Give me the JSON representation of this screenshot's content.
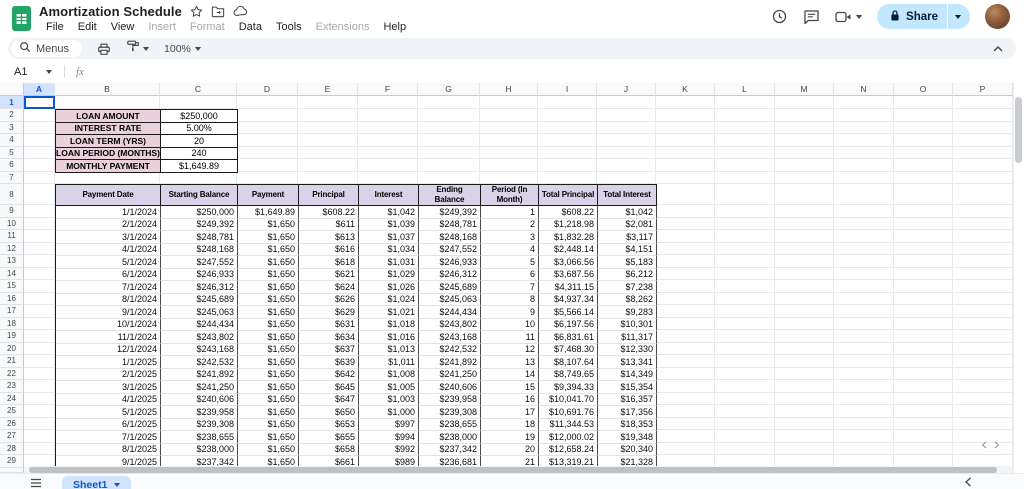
{
  "header": {
    "title": "Amortization Schedule",
    "menus": [
      {
        "label": "File",
        "muted": false
      },
      {
        "label": "Edit",
        "muted": false
      },
      {
        "label": "View",
        "muted": false
      },
      {
        "label": "Insert",
        "muted": true
      },
      {
        "label": "Format",
        "muted": true
      },
      {
        "label": "Data",
        "muted": false
      },
      {
        "label": "Tools",
        "muted": false
      },
      {
        "label": "Extensions",
        "muted": true
      },
      {
        "label": "Help",
        "muted": false
      }
    ],
    "share_label": "Share"
  },
  "toolbar": {
    "search_label": "Menus",
    "zoom_value": "100%"
  },
  "formula_bar": {
    "cell_reference": "A1",
    "formula_value": "",
    "fx_label": "fx"
  },
  "grid": {
    "column_letters": [
      "A",
      "B",
      "C",
      "D",
      "E",
      "F",
      "G",
      "H",
      "I",
      "J",
      "K",
      "L",
      "M",
      "N",
      "O",
      "P"
    ],
    "selected_column": "A",
    "selected_row": 1,
    "row_count": 29,
    "selected_cell": "A1"
  },
  "loan_summary": [
    {
      "label": "LOAN AMOUNT",
      "value": "$250,000"
    },
    {
      "label": "INTEREST RATE",
      "value": "5.00%"
    },
    {
      "label": "LOAN TERM (YRS)",
      "value": "20"
    },
    {
      "label": "LOAN PERIOD (MONTHS)",
      "value": "240"
    },
    {
      "label": "MONTHLY PAYMENT",
      "value": "$1,649.89"
    }
  ],
  "schedule": {
    "headers": [
      "Payment Date",
      "Starting Balance",
      "Payment",
      "Principal",
      "Interest",
      "Ending\nBalance",
      "Period (In\nMonth)",
      "Total Principal",
      "Total Interest"
    ],
    "rows": [
      [
        "1/1/2024",
        "$250,000",
        "$1,649.89",
        "$608.22",
        "$1,042",
        "$249,392",
        "1",
        "$608.22",
        "$1,042"
      ],
      [
        "2/1/2024",
        "$249,392",
        "$1,650",
        "$611",
        "$1,039",
        "$248,781",
        "2",
        "$1,218.98",
        "$2,081"
      ],
      [
        "3/1/2024",
        "$248,781",
        "$1,650",
        "$613",
        "$1,037",
        "$248,168",
        "3",
        "$1,832.28",
        "$3,117"
      ],
      [
        "4/1/2024",
        "$248,168",
        "$1,650",
        "$616",
        "$1,034",
        "$247,552",
        "4",
        "$2,448.14",
        "$4,151"
      ],
      [
        "5/1/2024",
        "$247,552",
        "$1,650",
        "$618",
        "$1,031",
        "$246,933",
        "5",
        "$3,066.56",
        "$5,183"
      ],
      [
        "6/1/2024",
        "$246,933",
        "$1,650",
        "$621",
        "$1,029",
        "$246,312",
        "6",
        "$3,687.56",
        "$6,212"
      ],
      [
        "7/1/2024",
        "$246,312",
        "$1,650",
        "$624",
        "$1,026",
        "$245,689",
        "7",
        "$4,311.15",
        "$7,238"
      ],
      [
        "8/1/2024",
        "$245,689",
        "$1,650",
        "$626",
        "$1,024",
        "$245,063",
        "8",
        "$4,937.34",
        "$8,262"
      ],
      [
        "9/1/2024",
        "$245,063",
        "$1,650",
        "$629",
        "$1,021",
        "$244,434",
        "9",
        "$5,566.14",
        "$9,283"
      ],
      [
        "10/1/2024",
        "$244,434",
        "$1,650",
        "$631",
        "$1,018",
        "$243,802",
        "10",
        "$6,197.56",
        "$10,301"
      ],
      [
        "11/1/2024",
        "$243,802",
        "$1,650",
        "$634",
        "$1,016",
        "$243,168",
        "11",
        "$6,831.61",
        "$11,317"
      ],
      [
        "12/1/2024",
        "$243,168",
        "$1,650",
        "$637",
        "$1,013",
        "$242,532",
        "12",
        "$7,468.30",
        "$12,330"
      ],
      [
        "1/1/2025",
        "$242,532",
        "$1,650",
        "$639",
        "$1,011",
        "$241,892",
        "13",
        "$8,107.64",
        "$13,341"
      ],
      [
        "2/1/2025",
        "$241,892",
        "$1,650",
        "$642",
        "$1,008",
        "$241,250",
        "14",
        "$8,749.65",
        "$14,349"
      ],
      [
        "3/1/2025",
        "$241,250",
        "$1,650",
        "$645",
        "$1,005",
        "$240,606",
        "15",
        "$9,394.33",
        "$15,354"
      ],
      [
        "4/1/2025",
        "$240,606",
        "$1,650",
        "$647",
        "$1,003",
        "$239,958",
        "16",
        "$10,041.70",
        "$16,357"
      ],
      [
        "5/1/2025",
        "$239,958",
        "$1,650",
        "$650",
        "$1,000",
        "$239,308",
        "17",
        "$10,691.76",
        "$17,356"
      ],
      [
        "6/1/2025",
        "$239,308",
        "$1,650",
        "$653",
        "$997",
        "$238,655",
        "18",
        "$11,344.53",
        "$18,353"
      ],
      [
        "7/1/2025",
        "$238,655",
        "$1,650",
        "$655",
        "$994",
        "$238,000",
        "19",
        "$12,000.02",
        "$19,348"
      ],
      [
        "8/1/2025",
        "$238,000",
        "$1,650",
        "$658",
        "$992",
        "$237,342",
        "20",
        "$12,658.24",
        "$20,340"
      ],
      [
        "9/1/2025",
        "$237,342",
        "$1,650",
        "$661",
        "$989",
        "$236,681",
        "21",
        "$13,319.21",
        "$21,328"
      ]
    ]
  },
  "sheet_bar": {
    "active_tab": "Sheet1"
  },
  "colors": {
    "brand_green": "#21a366",
    "accent_blue": "#0b57d0",
    "share_bg": "#c2e7ff",
    "share_text": "#001d35",
    "label_pink": "#ead1dc",
    "header_lavender": "#d9d2e9",
    "selected_header_bg": "#d3e3fd",
    "toolbar_bg": "#f0f4f9"
  }
}
